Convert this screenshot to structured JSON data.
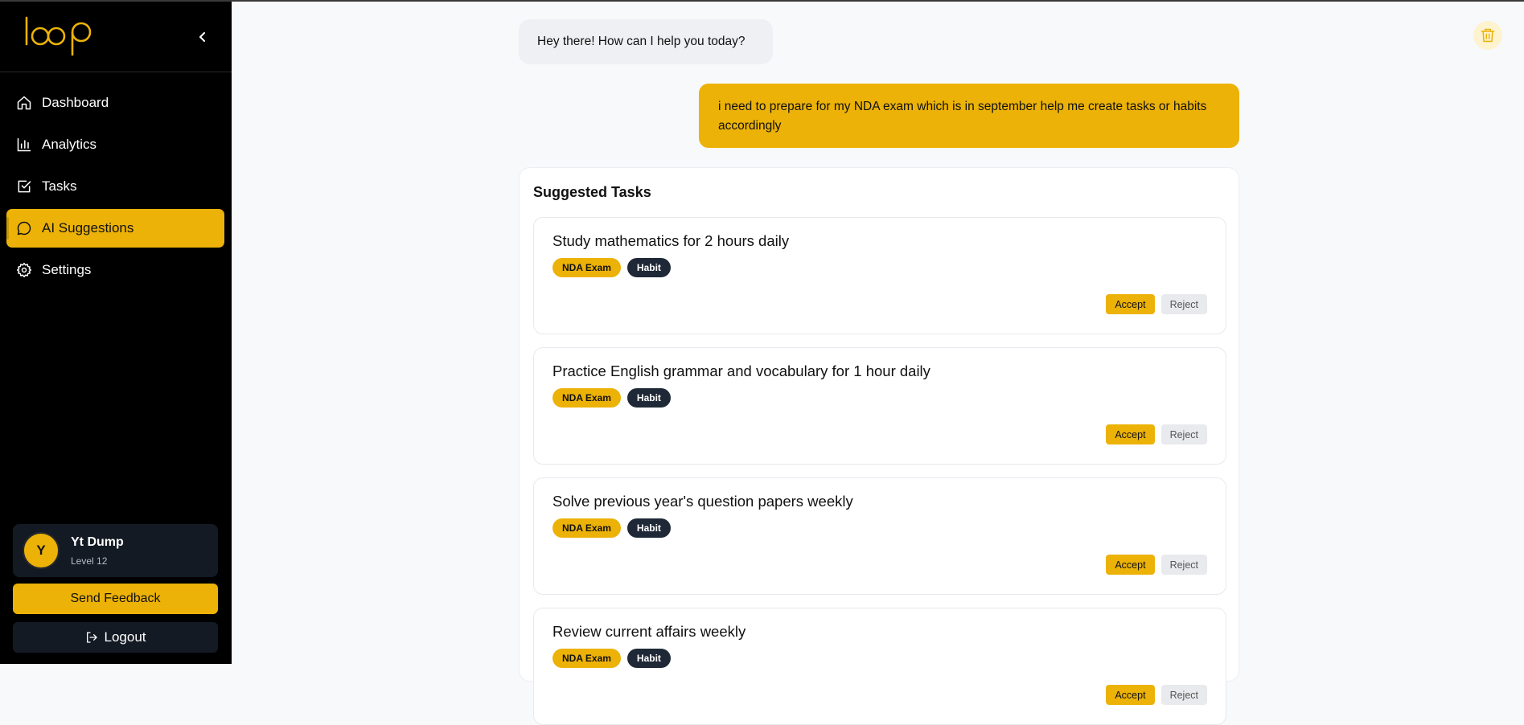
{
  "app": {
    "logo_text": "loop",
    "accent": "#ecb207"
  },
  "sidebar": {
    "items": [
      {
        "label": "Dashboard",
        "icon": "home-icon"
      },
      {
        "label": "Analytics",
        "icon": "bar-chart-icon"
      },
      {
        "label": "Tasks",
        "icon": "checkbox-icon"
      },
      {
        "label": "AI Suggestions",
        "icon": "chat-bubble-icon",
        "active": true
      },
      {
        "label": "Settings",
        "icon": "gear-icon"
      }
    ],
    "profile": {
      "initial": "Y",
      "name": "Yt Dump",
      "level": "Level 12"
    },
    "feedback_label": "Send Feedback",
    "logout_label": "Logout"
  },
  "chat": {
    "bot_message": "Hey there! How can I help you today?",
    "user_message": "i need to prepare for my NDA exam which is in september help me create tasks or habits accordingly"
  },
  "suggestions": {
    "title": "Suggested Tasks",
    "accept_label": "Accept",
    "reject_label": "Reject",
    "tasks": [
      {
        "title": "Study mathematics for 2 hours daily",
        "tags": [
          "NDA Exam",
          "Habit"
        ]
      },
      {
        "title": "Practice English grammar and vocabulary for 1 hour daily",
        "tags": [
          "NDA Exam",
          "Habit"
        ]
      },
      {
        "title": "Solve previous year's question papers weekly",
        "tags": [
          "NDA Exam",
          "Habit"
        ]
      },
      {
        "title": "Review current affairs weekly",
        "tags": [
          "NDA Exam",
          "Habit"
        ]
      }
    ]
  }
}
